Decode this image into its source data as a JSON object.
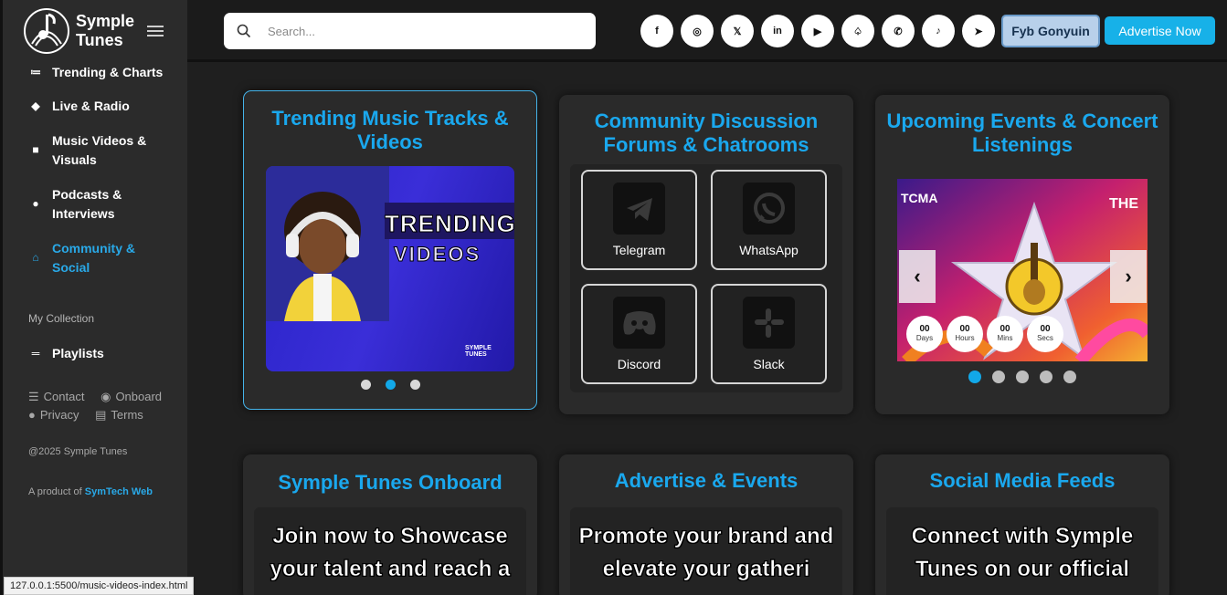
{
  "app": {
    "name_line1": "Symple",
    "name_line2": "Tunes"
  },
  "sidebar": {
    "items": [
      {
        "label": "Trending & Charts",
        "icon": "list-icon"
      },
      {
        "label": "Live & Radio",
        "icon": "diamond-icon"
      },
      {
        "label": "Music Videos & Visuals",
        "icon": "square-icon"
      },
      {
        "label": "Podcasts & Interviews",
        "icon": "disc-icon"
      },
      {
        "label": "Community & Social",
        "icon": "home-icon",
        "active": true
      }
    ],
    "collection_label": "My Collection",
    "playlists_label": "Playlists",
    "footer": {
      "contact": "Contact",
      "onboard": "Onboard",
      "privacy": "Privacy",
      "terms": "Terms"
    },
    "copyright": "@2025 Symple Tunes",
    "product_prefix": "A product of ",
    "product_link": "SymTech Web"
  },
  "header": {
    "search_placeholder": "Search...",
    "socials": [
      "facebook-icon",
      "instagram-icon",
      "x-icon",
      "linkedin-icon",
      "youtube-icon",
      "snapchat-icon",
      "whatsapp-icon",
      "tiktok-icon",
      "telegram-icon"
    ],
    "social_glyphs": [
      "f",
      "◎",
      "𝕏",
      "in",
      "▶",
      "♤",
      "✆",
      "♪",
      "➤"
    ],
    "user_label": "Fyb Gonyuin",
    "advertise_label": "Advertise Now"
  },
  "cards": {
    "trending": {
      "title": "Trending Music Tracks & Videos",
      "banner_line1": "TRENDING",
      "banner_line2": "VIDEOS",
      "watermark": "SYMPLE TUNES"
    },
    "community": {
      "title": "Community Discussion Forums & Chatrooms",
      "tiles": [
        "Telegram",
        "WhatsApp",
        "Discord",
        "Slack"
      ]
    },
    "events": {
      "title": "Upcoming Events & Concert Listenings",
      "countdown": [
        {
          "value": "00",
          "unit": "Days"
        },
        {
          "value": "00",
          "unit": "Hours"
        },
        {
          "value": "00",
          "unit": "Mins"
        },
        {
          "value": "00",
          "unit": "Secs"
        }
      ],
      "prev": "‹",
      "next": "›"
    },
    "onboard": {
      "title": "Symple Tunes Onboard",
      "text_line1": "Join now to Showcase",
      "text_line2": "your talent and reach a"
    },
    "advertise": {
      "title": "Advertise & Events",
      "text_line1": "Promote your brand and",
      "text_line2": "elevate your gatheri"
    },
    "social": {
      "title": "Social Media Feeds",
      "text_line1": "Connect with Symple",
      "text_line2": "Tunes on our official"
    }
  },
  "status_url": "127.0.0.1:5500/music-videos-index.html",
  "colors": {
    "accent": "#1aa8ee",
    "card_bg": "#2a2a2a",
    "sidebar_bg": "#2b2b2b"
  }
}
